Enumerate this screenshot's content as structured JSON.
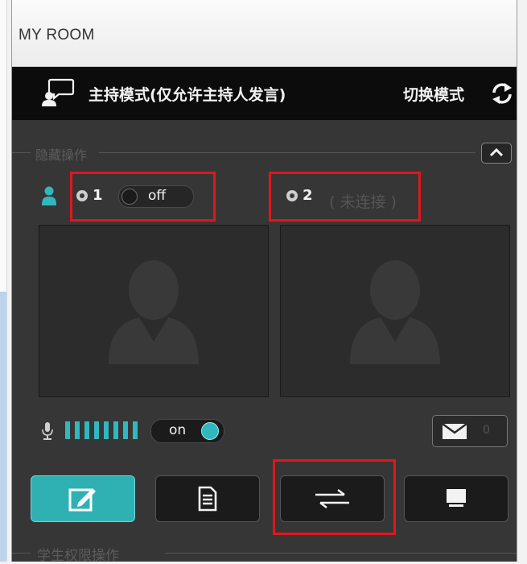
{
  "window": {
    "title": "MY ROOM"
  },
  "mode_bar": {
    "mode_label": "主持模式(仅允许主持人发言)",
    "switch_label": "切换模式",
    "host_icon": "host-speaker-icon",
    "switch_icon": "switch-arrows-icon"
  },
  "hidden_ops": {
    "label": "隐藏操作",
    "collapse_icon": "chevron-up-icon"
  },
  "cameras": [
    {
      "num": "1",
      "toggle_label": "off",
      "icon": "camera-icon"
    },
    {
      "num": "2",
      "status": "( 未连接 )",
      "icon": "camera-icon"
    }
  ],
  "audio": {
    "toggle_label": "on",
    "level_bars": 8,
    "mic_icon": "microphone-icon"
  },
  "messages": {
    "count": "0",
    "icon": "envelope-icon"
  },
  "toolbar": [
    {
      "icon": "edit-icon",
      "active": true
    },
    {
      "icon": "document-icon",
      "active": false
    },
    {
      "icon": "swap-arrows-icon",
      "active": false
    },
    {
      "icon": "monitor-icon",
      "active": false
    }
  ],
  "student_ops": {
    "label": "学生权限操作"
  },
  "colors": {
    "accent": "#30b8bd",
    "highlight": "#e3151c",
    "panel": "#363636"
  }
}
